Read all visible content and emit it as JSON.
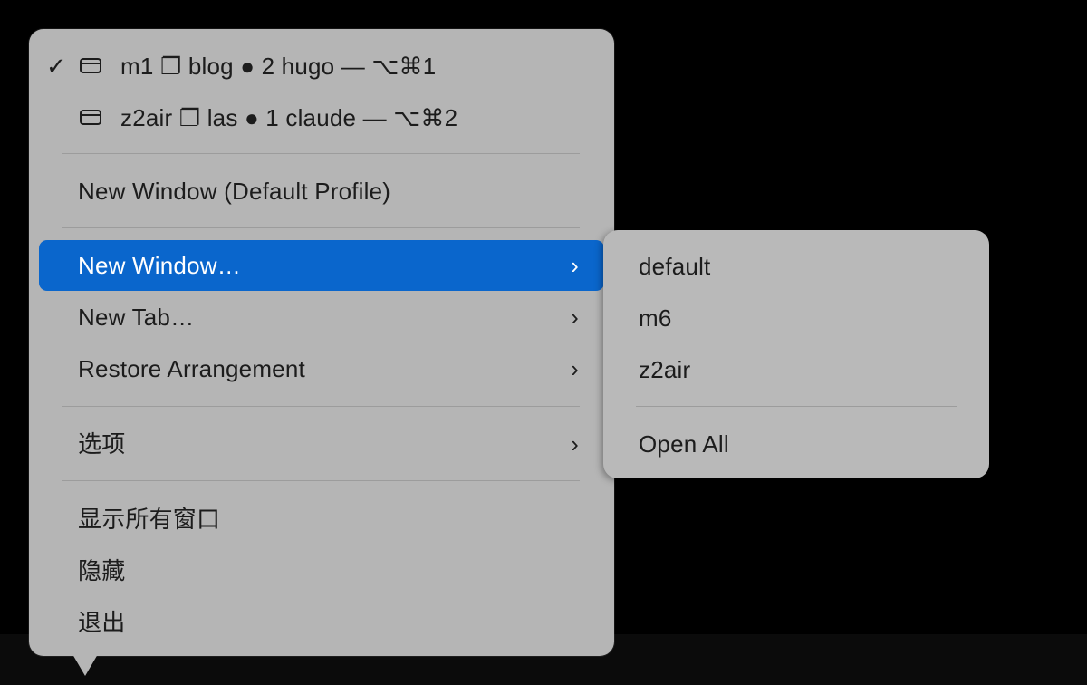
{
  "dock_menu": {
    "windows": [
      {
        "checked": true,
        "check_mark": "✓",
        "icon": "window-icon",
        "label": "m1 ❐ blog ● 2 hugo — ⌥⌘1"
      },
      {
        "checked": false,
        "check_mark": "",
        "icon": "window-icon",
        "label": "z2air ❐ las ● 1 claude — ⌥⌘2"
      }
    ],
    "new_window_default_profile": "New Window (Default Profile)",
    "new_window": "New Window…",
    "new_tab": "New Tab…",
    "restore_arrangement": "Restore Arrangement",
    "options": "选项",
    "show_all_windows": "显示所有窗口",
    "hide": "隐藏",
    "quit": "退出",
    "submenu_chevron": "›"
  },
  "submenu": {
    "profiles": [
      "default",
      "m6",
      "z2air"
    ],
    "open_all": "Open All"
  },
  "colors": {
    "highlight": "#0a66cc",
    "menu_background": "#b5b5b5",
    "text": "#1c1c1c"
  }
}
